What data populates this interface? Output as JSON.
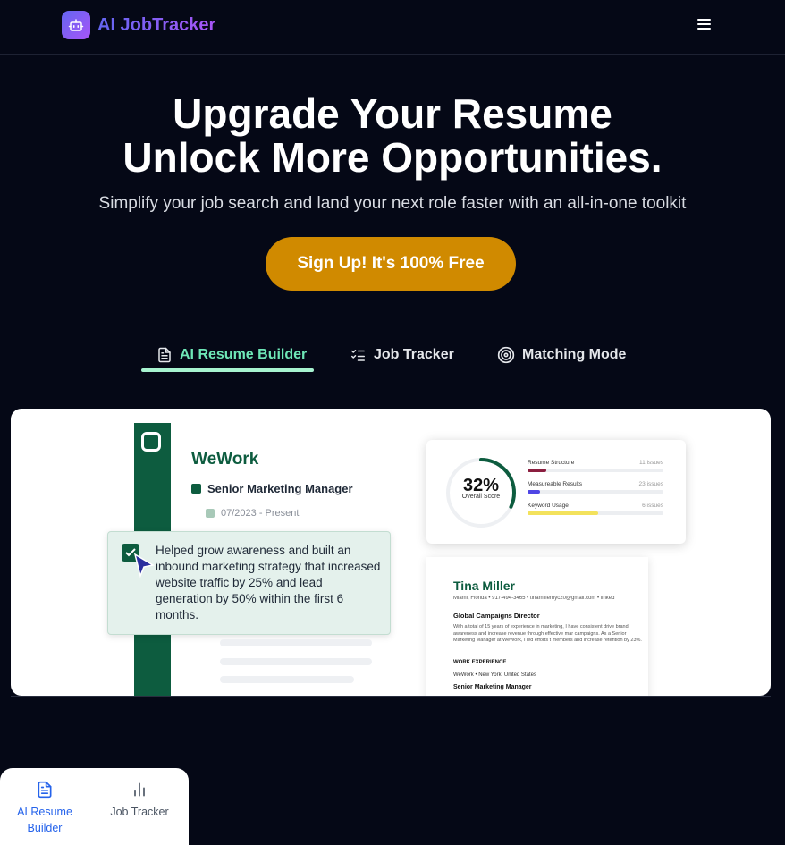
{
  "header": {
    "app_name": "AI JobTracker",
    "logo_icon": "robot-icon",
    "menu_icon": "hamburger-icon"
  },
  "hero": {
    "title_line1": "Upgrade Your Resume",
    "title_line2": "Unlock More Opportunities.",
    "subtitle": "Simplify your job search and land your next role faster with an all-in-one toolkit",
    "cta_label": "Sign Up! It's 100% Free"
  },
  "tabs": [
    {
      "label": "AI Resume Builder",
      "icon": "document-icon",
      "active": true
    },
    {
      "label": "Job Tracker",
      "icon": "checklist-icon",
      "active": false
    },
    {
      "label": "Matching Mode",
      "icon": "target-icon",
      "active": false
    }
  ],
  "preview": {
    "company": "WeWork",
    "role": "Senior Marketing Manager",
    "dates": "07/2023 - Present",
    "bullet": "Helped grow awareness and built an inbound marketing strategy that increased website traffic by 25% and lead generation by 50% within the first 6 months.",
    "score": {
      "percent": "32%",
      "label": "Overall Score",
      "value": 0.32
    },
    "metrics": [
      {
        "name": "Resume Structure",
        "issues": "11 issues",
        "fill": 0.14,
        "color": "#8b1e3f"
      },
      {
        "name": "Measureable Results",
        "issues": "23 issues",
        "fill": 0.09,
        "color": "#4f46e5"
      },
      {
        "name": "Keyword Usage",
        "issues": "6 issues",
        "fill": 0.52,
        "color": "#f3e25c"
      }
    ],
    "resume": {
      "name": "Tina Miller",
      "contact": "Miami, Florida • 917-494-3465 • tinamillernyc20@gmail.com • linked",
      "title": "Global Campaigns Director",
      "summary": "With a total of 15 years of experience in marketing, I have consistent drive brand awareness and increase revenue through effective mar campaigns. As a Senior Marketing Manager at WeWork, I led efforts t members and increase retention by 23%.",
      "section": "WORK EXPERIENCE",
      "company_line": "WeWork • New York, United States",
      "role": "Senior Marketing Manager"
    }
  },
  "bottom_nav": [
    {
      "label": "AI Resume Builder",
      "icon": "document-icon",
      "active": true
    },
    {
      "label": "Job Tracker",
      "icon": "bar-chart-icon",
      "active": false
    }
  ],
  "colors": {
    "background": "#050816",
    "cta": "#d08a00",
    "active_tab": "#6ee7b7",
    "brand_green": "#0d5c3f",
    "nav_active": "#2563eb"
  }
}
